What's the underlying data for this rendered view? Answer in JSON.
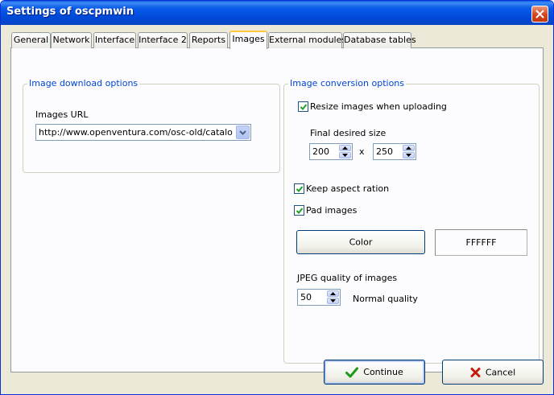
{
  "window": {
    "title": "Settings of oscpmwin"
  },
  "tabs": [
    {
      "label": "General"
    },
    {
      "label": "Network"
    },
    {
      "label": "Interface"
    },
    {
      "label": "Interface 2"
    },
    {
      "label": "Reports"
    },
    {
      "label": "Images"
    },
    {
      "label": "External modules"
    },
    {
      "label": "Database tables"
    }
  ],
  "active_tab": "Images",
  "download": {
    "legend": "Image download options",
    "url_label": "Images URL",
    "url_value": "http://www.openventura.com/osc-old/catalog/imag"
  },
  "conversion": {
    "legend": "Image conversion options",
    "resize_label": "Resize images when uploading",
    "resize_checked": true,
    "size_label": "Final desired size",
    "width_value": "200",
    "times": "x",
    "height_value": "250",
    "keep_aspect_label": "Keep aspect ration",
    "keep_aspect_checked": true,
    "pad_label": "Pad images",
    "pad_checked": true,
    "color_button_label": "Color",
    "color_value": "FFFFFF",
    "jpeg_label": "JPEG quality of images",
    "jpeg_value": "50",
    "quality_text": "Normal quality"
  },
  "footer": {
    "continue_label": "Continue",
    "cancel_label": "Cancel"
  },
  "icons": {
    "close": "close-icon",
    "dropdown": "chevron-down-icon",
    "check": "checkmark-icon",
    "continue": "green-check-icon",
    "cancel": "red-x-icon"
  },
  "colors": {
    "titlebar": "#0a5ae9",
    "legend_text": "#0046d5",
    "dialog_bg": "#ece9d8",
    "active_tab_accent": "#ffc83c"
  }
}
